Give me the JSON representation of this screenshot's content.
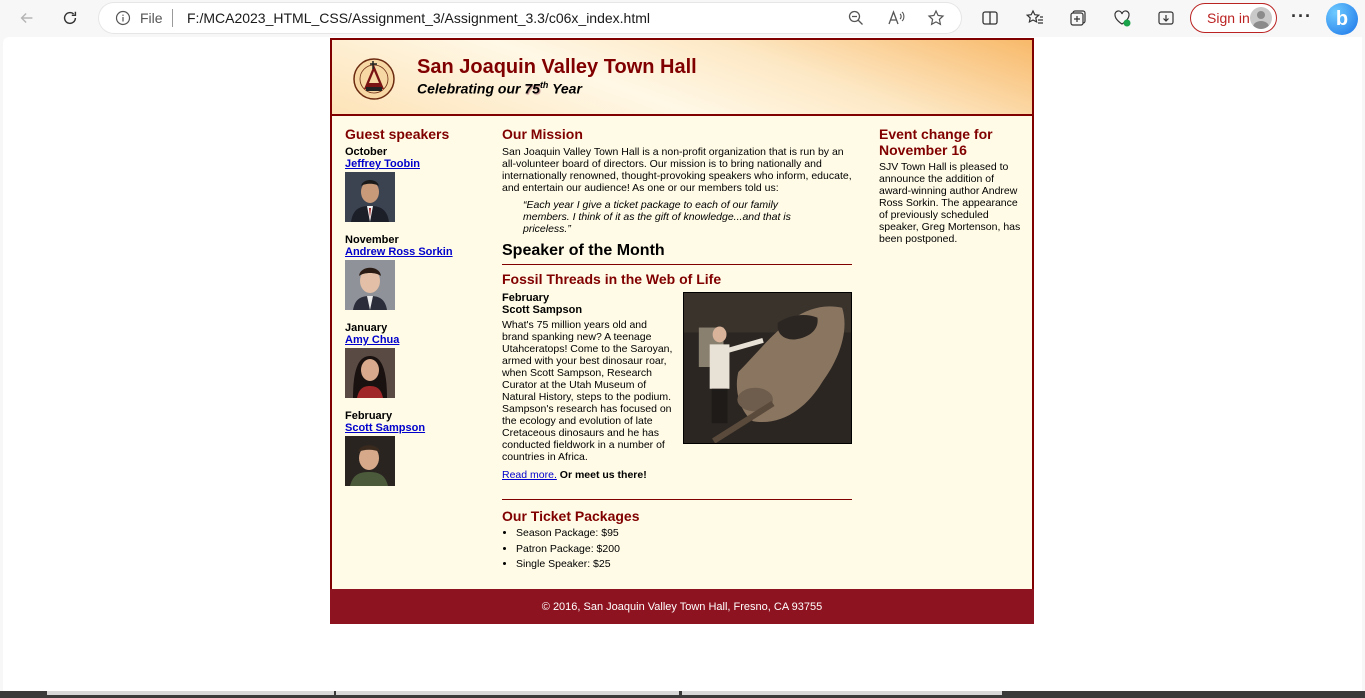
{
  "browser": {
    "file_label": "File",
    "url": "F:/MCA2023_HTML_CSS/Assignment_3/Assignment_3.3/c06x_index.html",
    "signin_label": "Sign in",
    "more_label": "···",
    "bing_label": "b"
  },
  "site": {
    "title": "San Joaquin Valley Town Hall",
    "tagline_pre": "Celebrating our ",
    "tagline_num": "75",
    "tagline_sup": "th",
    "tagline_post": " Year"
  },
  "guest": {
    "heading": "Guest speakers",
    "speakers": [
      {
        "month": "October",
        "name": "Jeffrey Toobin"
      },
      {
        "month": "November",
        "name": "Andrew Ross Sorkin"
      },
      {
        "month": "January",
        "name": "Amy Chua"
      },
      {
        "month": "February",
        "name": "Scott Sampson"
      }
    ]
  },
  "mission": {
    "heading": "Our Mission",
    "text": "San Joaquin Valley Town Hall is a non-profit organization that is run by an all-volunteer board of directors. Our mission is to bring nationally and internationally renowned, thought-provoking speakers who inform, educate, and entertain our audience! As one or our members told us:",
    "quote": "“Each year I give a ticket package to each of our family members. I think of it as the gift of knowledge...and that is priceless.”"
  },
  "speaker_of_month": {
    "heading": "Speaker of the Month",
    "talk_title": "Fossil Threads in the Web of Life",
    "month": "February",
    "speaker": "Scott Sampson",
    "description": "What's 75 million years old and brand spanking new? A teenage Utahceratops! Come to the Saroyan, armed with your best dinosaur roar, when Scott Sampson, Research Curator at the Utah Museum of Natural History, steps to the podium. Sampson's research has focused on the ecology and evolution of late Cretaceous dinosaurs and he has conducted fieldwork in a number of countries in Africa.",
    "read_more": "Read more.",
    "meet": "Or meet us there!"
  },
  "tickets": {
    "heading": "Our Ticket Packages",
    "items": [
      "Season Package: $95",
      "Patron Package: $200",
      "Single Speaker: $25"
    ]
  },
  "event": {
    "heading": "Event change for November 16",
    "text": "SJV Town Hall is pleased to announce the addition of award-winning author Andrew Ross Sorkin. The appearance of previously scheduled speaker, Greg Mortenson, has been postponed."
  },
  "footer": {
    "text": "© 2016, San Joaquin Valley Town Hall, Fresno, CA 93755"
  }
}
